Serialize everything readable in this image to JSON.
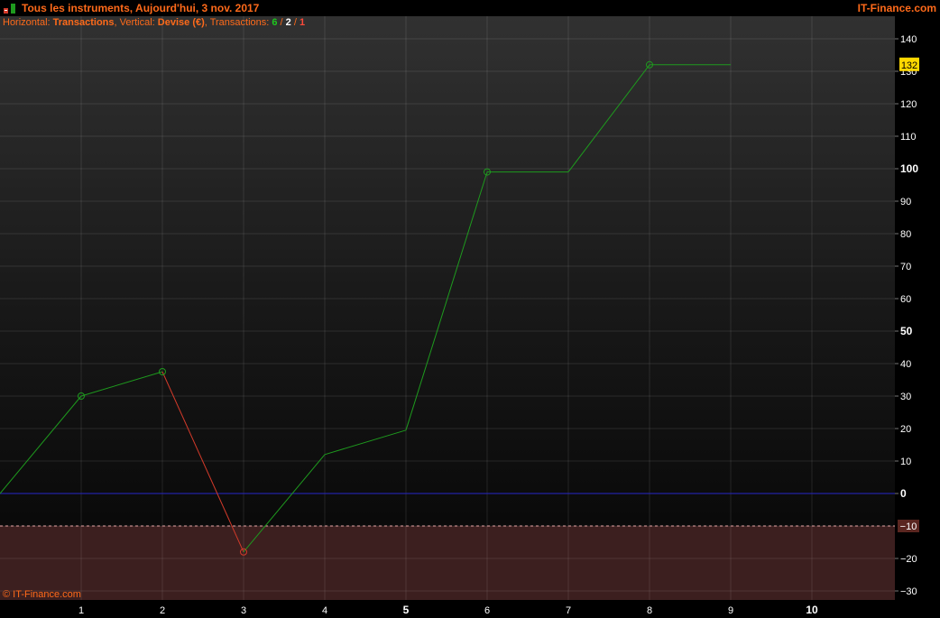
{
  "window": {
    "title": "Tous les instruments, Aujourd'hui, 3 nov. 2017",
    "brand": "IT-Finance.com"
  },
  "info": {
    "horizontal_label": "Horizontal: ",
    "horizontal_value": "Transactions",
    "vertical_label": ", Vertical: ",
    "vertical_value": "Devise (€)",
    "transactions_label": ", Transactions: ",
    "count_total": "6",
    "sep1": " / ",
    "count_winning": "2",
    "sep2": " / ",
    "count_losing": "1"
  },
  "copyright": "© IT-Finance.com",
  "colors": {
    "positive": "#1e9a1e",
    "negative": "#d33a2a",
    "zero_line": "#2626c8",
    "orange": "#ff6a1a",
    "last_value_badge": "#ffd800",
    "threshold_badge": "#5a2620",
    "negative_zone": "#3c1f1f"
  },
  "chart_data": {
    "type": "line",
    "x": [
      0,
      1,
      2,
      3,
      4,
      5,
      6,
      7,
      8,
      9
    ],
    "y": [
      0,
      30,
      37.5,
      -18,
      12,
      19.5,
      99,
      99,
      132,
      132
    ],
    "markers_at_x": [
      1,
      2,
      3,
      6,
      8
    ],
    "segment_colors": [
      "positive",
      "positive",
      "negative",
      "positive",
      "positive",
      "positive",
      "positive",
      "positive",
      "positive"
    ],
    "xlim": [
      0,
      11
    ],
    "ylim": [
      -33,
      146
    ],
    "x_ticks": [
      {
        "value": 1,
        "label": "1",
        "bold": false
      },
      {
        "value": 2,
        "label": "2",
        "bold": false
      },
      {
        "value": 3,
        "label": "3",
        "bold": false
      },
      {
        "value": 4,
        "label": "4",
        "bold": false
      },
      {
        "value": 5,
        "label": "5",
        "bold": true
      },
      {
        "value": 6,
        "label": "6",
        "bold": false
      },
      {
        "value": 7,
        "label": "7",
        "bold": false
      },
      {
        "value": 8,
        "label": "8",
        "bold": false
      },
      {
        "value": 9,
        "label": "9",
        "bold": false
      },
      {
        "value": 10,
        "label": "10",
        "bold": true
      }
    ],
    "y_ticks": [
      {
        "value": 140,
        "label": "140",
        "bold": false
      },
      {
        "value": 130,
        "label": "130",
        "bold": false
      },
      {
        "value": 120,
        "label": "120",
        "bold": false
      },
      {
        "value": 110,
        "label": "110",
        "bold": false
      },
      {
        "value": 100,
        "label": "100",
        "bold": true
      },
      {
        "value": 90,
        "label": "90",
        "bold": false
      },
      {
        "value": 80,
        "label": "80",
        "bold": false
      },
      {
        "value": 70,
        "label": "70",
        "bold": false
      },
      {
        "value": 60,
        "label": "60",
        "bold": false
      },
      {
        "value": 50,
        "label": "50",
        "bold": true
      },
      {
        "value": 40,
        "label": "40",
        "bold": false
      },
      {
        "value": 30,
        "label": "30",
        "bold": false
      },
      {
        "value": 20,
        "label": "20",
        "bold": false
      },
      {
        "value": 10,
        "label": "10",
        "bold": false
      },
      {
        "value": 0,
        "label": "0",
        "bold": true
      },
      {
        "value": -20,
        "label": "−20",
        "bold": false
      },
      {
        "value": -30,
        "label": "−30",
        "bold": false
      }
    ],
    "zero_line": 0,
    "threshold": {
      "value": -10,
      "label": "−10"
    },
    "last_value": {
      "value": 132,
      "label": "132"
    },
    "grid": true
  }
}
